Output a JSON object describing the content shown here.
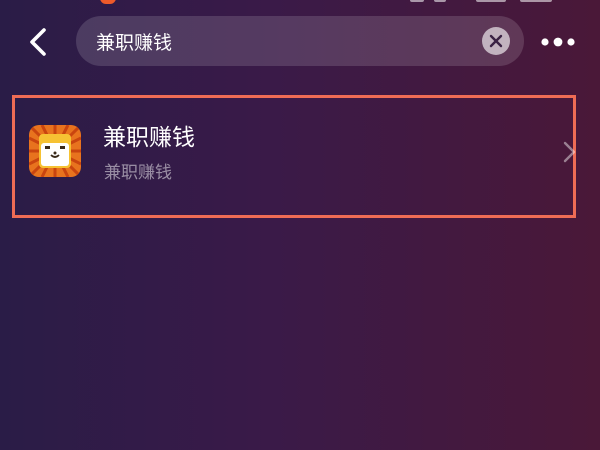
{
  "search": {
    "value": "兼职赚钱"
  },
  "results": [
    {
      "title": "兼职赚钱",
      "subtitle": "兼职赚钱",
      "icon": "lion-app-icon"
    }
  ],
  "colors": {
    "highlight_border": "#ee6c55",
    "status_accent": "#ee5a2a"
  }
}
